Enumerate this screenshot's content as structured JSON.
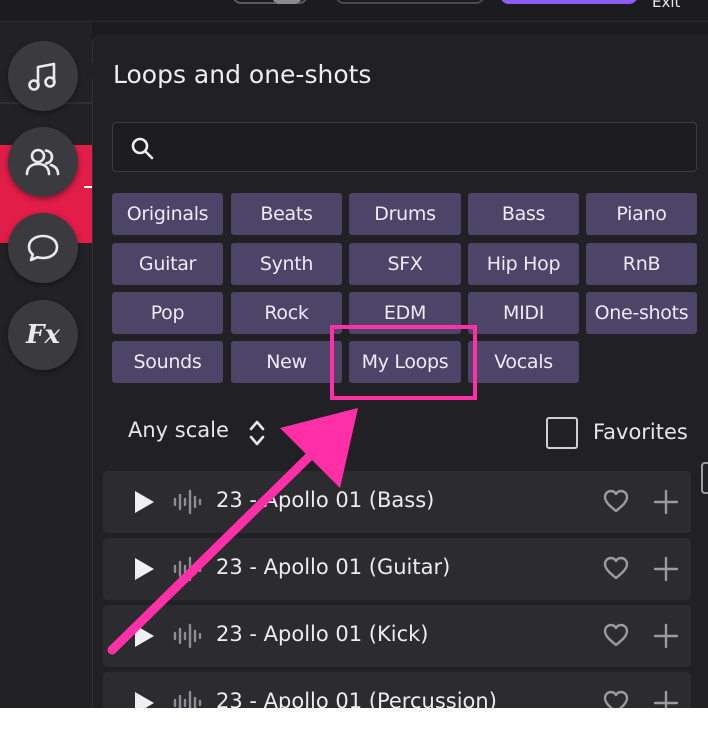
{
  "top": {
    "exit_label": "Exit"
  },
  "panel": {
    "title": "Loops and one-shots"
  },
  "search": {
    "value": "",
    "placeholder": ""
  },
  "tags": [
    "Originals",
    "Beats",
    "Drums",
    "Bass",
    "Piano",
    "Guitar",
    "Synth",
    "SFX",
    "Hip Hop",
    "RnB",
    "Pop",
    "Rock",
    "EDM",
    "MIDI",
    "One-shots",
    "Sounds",
    "New",
    "My Loops",
    "Vocals"
  ],
  "filters": {
    "scale_label": "Any scale",
    "favorites_label": "Favorites"
  },
  "loops": [
    {
      "title": "23 - Apollo 01 (Bass)"
    },
    {
      "title": "23 - Apollo 01 (Guitar)"
    },
    {
      "title": "23 - Apollo 01 (Kick)"
    },
    {
      "title": "23 - Apollo 01 (Percussion)"
    }
  ],
  "colors": {
    "accent": "#8b5cf6",
    "tag_bg": "#4d4568",
    "highlight": "#ff2fa8",
    "track_red": "#e11d48"
  },
  "icons": {
    "sidebar": [
      "music-note-icon",
      "users-icon",
      "chat-icon",
      "fx-icon"
    ],
    "row": [
      "play-icon",
      "waveform-icon",
      "heart-icon",
      "plus-icon"
    ]
  },
  "sidebar": {
    "fx_label": "Fx"
  }
}
